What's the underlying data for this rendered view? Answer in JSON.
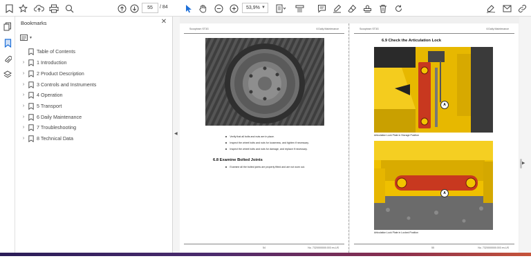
{
  "toolbar": {
    "current_page": "55",
    "page_total": "/ 84",
    "zoom": "53,9%"
  },
  "bookmarks": {
    "title": "Bookmarks",
    "items": [
      {
        "label": "Table of Contents",
        "expandable": false
      },
      {
        "label": "1 Introduction",
        "expandable": true
      },
      {
        "label": "2 Product Description",
        "expandable": true
      },
      {
        "label": "3 Controls and Instruments",
        "expandable": true
      },
      {
        "label": "4 Operation",
        "expandable": true
      },
      {
        "label": "5 Transport",
        "expandable": true
      },
      {
        "label": "6 Daily Maintenance",
        "expandable": true
      },
      {
        "label": "7 Troubleshooting",
        "expandable": true
      },
      {
        "label": "8 Technical Data",
        "expandable": true
      }
    ]
  },
  "left_page": {
    "header_left": "Scooptram ST3G",
    "header_right": "6 Daily Maintenance",
    "bullets": [
      "Verify that all bolts and nuts are in place.",
      "Inspect the wheel bolts and nuts for looseness, and tighten if necessary.",
      "Inspect the wheel bolts and nuts for damage, and replace if necessary."
    ],
    "section_title": "6.8   Examine Bolted Joints",
    "section_bullet": "Examine all the bolted joints are properly fitted and are not worn out.",
    "footer_page": "54",
    "footer_doc": "No. 7320000000.003 en-US"
  },
  "right_page": {
    "header_left": "Scooptram ST3G",
    "header_right": "6 Daily Maintenance",
    "section_title": "6.9   Check the Articulation Lock",
    "marker_a": "A",
    "caption_top": "Articulation Lock Plate in Storage Position",
    "caption_bottom": "Articulation Lock Plate in Locked Position",
    "footer_page": "55",
    "footer_doc": "No. 7320000000.003 en-US"
  },
  "colors": {
    "accent_blue": "#1d6fd8",
    "machine_yellow": "#f2c400",
    "lock_red": "#c8381f"
  }
}
